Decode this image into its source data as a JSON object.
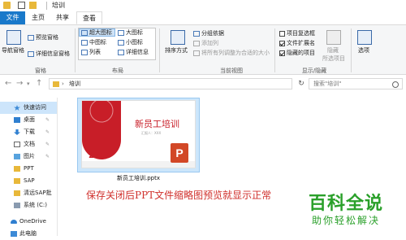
{
  "window": {
    "title": "培训"
  },
  "tabs": [
    "文件",
    "主页",
    "共享",
    "查看"
  ],
  "ribbon": {
    "panes": {
      "nav_pane": "导航窗格",
      "preview_pane": "预览窗格",
      "details_pane": "详细信息窗格",
      "group_label": "窗格"
    },
    "layout": {
      "items": [
        "超大图标",
        "大图标",
        "中图标",
        "小图标",
        "列表",
        "详细信息"
      ],
      "group_label": "布局"
    },
    "current_view": {
      "sort": "排序方式",
      "group_by": "分组依据",
      "add_column": "添加列",
      "fit_columns": "将所有列调整为合适的大小",
      "group_label": "当前视图"
    },
    "show_hide": {
      "item_checkboxes": {
        "label": "项目复选框",
        "checked": false
      },
      "file_extensions": {
        "label": "文件扩展名",
        "checked": true
      },
      "hidden_items": {
        "label": "隐藏的项目",
        "checked": true
      },
      "hide_selected": "隐藏",
      "hide_selected2": "所选项目",
      "group_label": "显示/隐藏"
    },
    "options": "选项"
  },
  "address": {
    "path": "培训",
    "search_placeholder": "搜索\"培训\""
  },
  "nav": [
    {
      "label": "快速访问",
      "icon": "star-icon",
      "pinned": false
    },
    {
      "label": "桌面",
      "icon": "desktop-icon",
      "pinned": true
    },
    {
      "label": "下载",
      "icon": "download-icon",
      "pinned": true
    },
    {
      "label": "文档",
      "icon": "document-icon",
      "pinned": true
    },
    {
      "label": "图片",
      "icon": "picture-icon",
      "pinned": true
    },
    {
      "label": "PPT",
      "icon": "folder-icon",
      "pinned": false
    },
    {
      "label": "SAP",
      "icon": "folder-icon",
      "pinned": false
    },
    {
      "label": "清远SAP批",
      "icon": "folder-icon",
      "pinned": false
    },
    {
      "label": "系统 (C:)",
      "icon": "drive-icon",
      "pinned": false
    },
    {
      "label": "OneDrive",
      "icon": "cloud-icon",
      "pinned": false
    },
    {
      "label": "此电脑",
      "icon": "computer-icon",
      "pinned": false
    }
  ],
  "file": {
    "name": "新员工培训.pptx",
    "slide_title": "新员工培训",
    "slide_year": "2018",
    "slide_sub": "汇报人：XXX"
  },
  "caption": "保存关闭后PPT文件缩略图预览就显示正常",
  "watermark": {
    "line1": "百科全说",
    "line2": "助你轻松解决"
  },
  "colors": {
    "accent": "#1979ca",
    "slide_red": "#c81e28",
    "caption": "#d0312d",
    "watermark": "#2aa02a"
  }
}
